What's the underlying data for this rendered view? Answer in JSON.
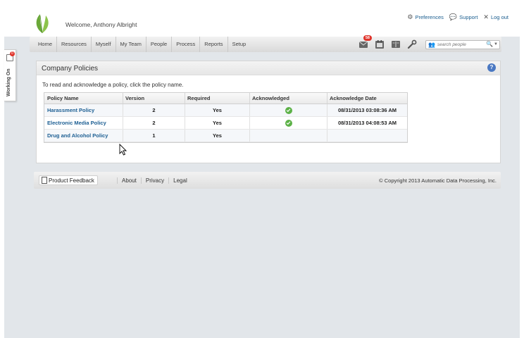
{
  "header": {
    "welcome": "Welcome, Anthony Albright",
    "links": {
      "preferences": "Preferences",
      "support": "Support",
      "logout": "Log out"
    }
  },
  "nav": {
    "items": [
      "Home",
      "Resources",
      "Myself",
      "My Team",
      "People",
      "Process",
      "Reports",
      "Setup"
    ],
    "inbox_count": "58",
    "search_placeholder": "search people"
  },
  "working_on": {
    "label": "Working On",
    "count": "0"
  },
  "panel": {
    "title": "Company Policies",
    "help": "?",
    "instructions": "To read and acknowledge a policy, click the policy name."
  },
  "table": {
    "headers": [
      "Policy Name",
      "Version",
      "Required",
      "Acknowledged",
      "Acknowledge Date"
    ],
    "rows": [
      {
        "name": "Harassment Policy",
        "version": "2",
        "required": "Yes",
        "acknowledged": true,
        "date": "08/31/2013 03:08:36 AM"
      },
      {
        "name": "Electronic Media Policy",
        "version": "2",
        "required": "Yes",
        "acknowledged": true,
        "date": "08/31/2013 04:08:53 AM"
      },
      {
        "name": "Drug and Alcohol Policy",
        "version": "1",
        "required": "Yes",
        "acknowledged": false,
        "date": ""
      }
    ]
  },
  "footer": {
    "feedback": "Product Feedback",
    "links": [
      "About",
      "Privacy",
      "Legal"
    ],
    "copyright": "© Copyright 2013 Automatic Data Processing, Inc."
  },
  "colors": {
    "link": "#1d5f93",
    "check": "#5cb147",
    "badge": "#e0342b",
    "background": "#e2e6ea"
  }
}
